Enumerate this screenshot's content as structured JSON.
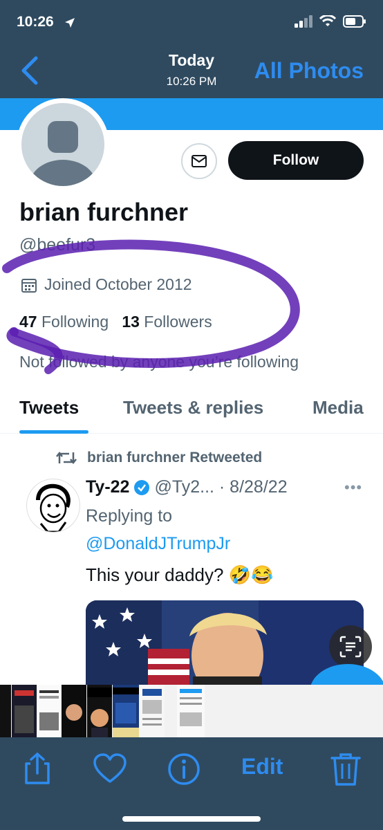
{
  "status": {
    "time": "10:26"
  },
  "nav": {
    "title": "Today",
    "subtitle": "10:26 PM",
    "right": "All Photos"
  },
  "profile": {
    "follow_label": "Follow",
    "name": "brian furchner",
    "handle": "@beefur3",
    "joined": "Joined October 2012",
    "following_count": "47",
    "following_label": "Following",
    "followers_count": "13",
    "followers_label": "Followers",
    "not_followed": "Not followed by anyone you’re following"
  },
  "tabs": [
    "Tweets",
    "Tweets & replies",
    "Media"
  ],
  "tweet": {
    "retweeted_by": "brian furchner Retweeted",
    "author_name": "Ty-22",
    "author_meta": "@Ty2... · 8/28/22",
    "replying_label": "Replying to",
    "replying_to": "@DonaldJTrumpJr",
    "text": "This your daddy? 🤣😂"
  },
  "toolbar": {
    "edit_label": "Edit"
  },
  "colors": {
    "accent": "#1d9bf0",
    "photos_bar": "#2f4a5f",
    "photos_blue": "#2e8cf0",
    "scribble": "#5a1fb0"
  }
}
